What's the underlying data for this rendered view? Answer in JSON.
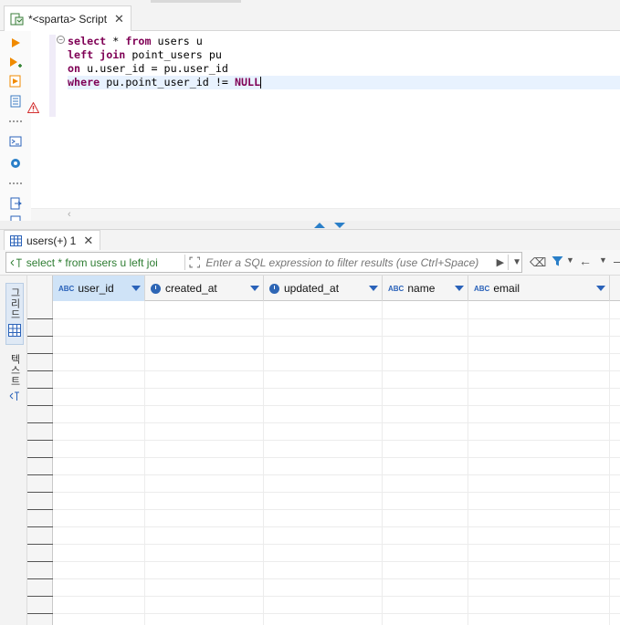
{
  "editor_tab": {
    "title": "*<sparta> Script"
  },
  "editor": {
    "lines": [
      {
        "parts": [
          {
            "t": "select",
            "kw": true
          },
          {
            "t": " * "
          },
          {
            "t": "from",
            "kw": true
          },
          {
            "t": " users u"
          }
        ]
      },
      {
        "parts": [
          {
            "t": "left join",
            "kw": true
          },
          {
            "t": " point_users pu"
          }
        ]
      },
      {
        "parts": [
          {
            "t": "on",
            "kw": true
          },
          {
            "t": " u.user_id = pu.user_id"
          }
        ]
      },
      {
        "parts": [
          {
            "t": "where",
            "kw": true
          },
          {
            "t": " pu.point_user_id != "
          },
          {
            "t": "NULL",
            "kw": true
          }
        ]
      }
    ]
  },
  "results_tab": {
    "title": "users(+) 1"
  },
  "filter": {
    "query": "select * from users u left joi",
    "placeholder": "Enter a SQL expression to filter results (use Ctrl+Space)"
  },
  "side_panel": {
    "grid_label": "그리드",
    "text_label": "텍스트"
  },
  "grid": {
    "columns": [
      {
        "name": "user_id",
        "type": "text-type",
        "selected": true
      },
      {
        "name": "created_at",
        "type": "datetime-type"
      },
      {
        "name": "updated_at",
        "type": "datetime-type"
      },
      {
        "name": "name",
        "type": "text-type"
      },
      {
        "name": "email",
        "type": "text-type"
      }
    ],
    "rows": []
  },
  "colors": {
    "keyword": "#7f0055",
    "accent": "#2a62b9",
    "filter_query": "#2e7d32"
  }
}
